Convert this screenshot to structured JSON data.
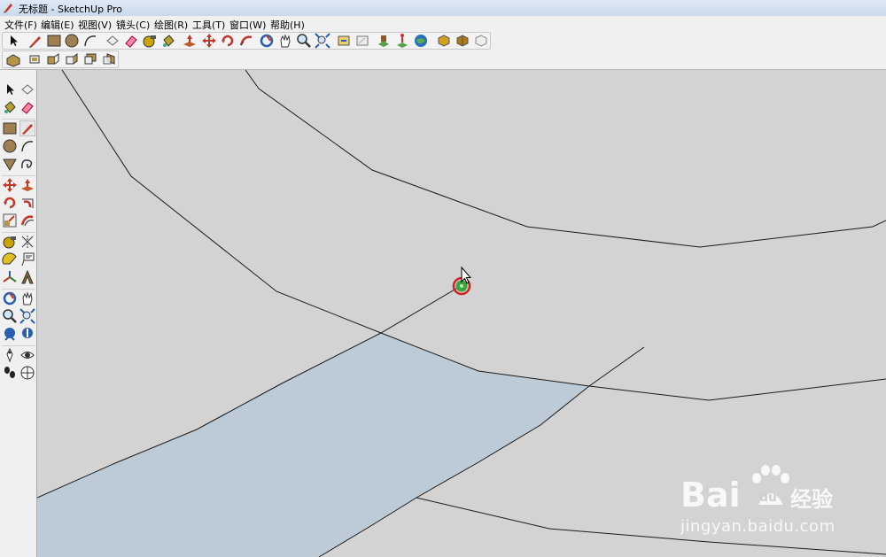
{
  "window": {
    "title": "无标题 - SketchUp Pro"
  },
  "menu": {
    "file": "文件(F)",
    "edit": "编辑(E)",
    "view": "视图(V)",
    "camera": "镜头(C)",
    "draw": "绘图(R)",
    "tools": "工具(T)",
    "window": "窗口(W)",
    "help": "帮助(H)"
  },
  "icons": {
    "top_row1": [
      "select-icon",
      "pencil-icon",
      "rectangle-icon",
      "circle-icon",
      "arc-icon",
      "make-component-icon",
      "eraser-icon",
      "tape-measure-icon",
      "paint-bucket-icon",
      "push-pull-icon",
      "move-icon",
      "rotate-icon",
      "follow-me-icon",
      "orbit-icon",
      "pan-icon",
      "zoom-icon",
      "zoom-extents-icon",
      "get-models-icon",
      "share-model-icon",
      "place-model-icon",
      "location-icon",
      "google-earth-icon",
      "get-components-icon",
      "share-component-icon",
      "component-icon"
    ],
    "top_row2": [
      "iso-view-icon",
      "top-view-icon",
      "front-view-icon",
      "right-view-icon",
      "back-view-icon",
      "left-view-icon"
    ]
  },
  "colors": {
    "viewport": "#d3d3d3",
    "face": "#bccbd6",
    "edge": "#1a1a1a",
    "snap_endpoint": "#3aa63a",
    "snap_ring": "#d42020"
  },
  "watermark": {
    "logo": "Bai du 经验",
    "url": "jingyan.baidu.com"
  }
}
